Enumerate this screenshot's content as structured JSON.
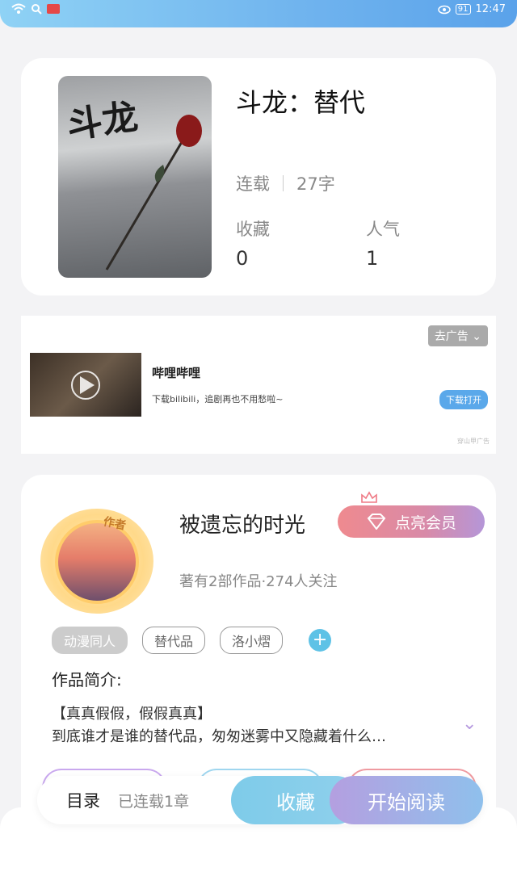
{
  "status_bar": {
    "time": "12:47",
    "battery": "91"
  },
  "book": {
    "cover_text": "斗龙",
    "title": "斗龙：替代",
    "status": "连载",
    "word_count": "27字",
    "stats": [
      {
        "label": "收藏",
        "value": "0"
      },
      {
        "label": "人气",
        "value": "1"
      }
    ]
  },
  "ad": {
    "close_label": "去广告",
    "title": "哔哩哔哩",
    "description": "下载bilibili，追剧再也不用愁啦~",
    "button": "下载打开",
    "source": "穿山甲广告"
  },
  "author": {
    "badge": "作者",
    "name": "被遗忘的时光",
    "vip_button": "点亮会员",
    "meta": "著有2部作品·274人关注",
    "tags": [
      "动漫同人",
      "替代品",
      "洛小熠"
    ],
    "intro_heading": "作品简介:",
    "intro_line1": "【真真假假，假假真真】",
    "intro_line2": "到底谁才是谁的替代品，匆匆迷雾中又隐藏着什么…"
  },
  "action_bar": {
    "toc": "目录",
    "serial": "已连载1章",
    "favorite": "收藏",
    "start_reading": "开始阅读"
  },
  "colors": {
    "accent_blue": "#5ec2e6",
    "accent_purple": "#b49fe0",
    "vip_pink": "#ef8a8f"
  }
}
